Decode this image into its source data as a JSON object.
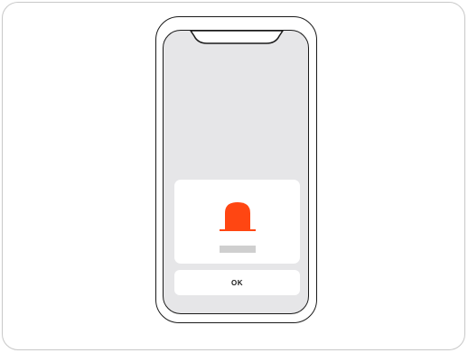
{
  "dialog": {
    "icon": "siren-icon",
    "ok_label": "OK"
  },
  "colors": {
    "accent": "#ff4612",
    "screen_background": "#e6e6e8",
    "placeholder": "#cfcfcf",
    "frame": "#1a1a1a"
  }
}
